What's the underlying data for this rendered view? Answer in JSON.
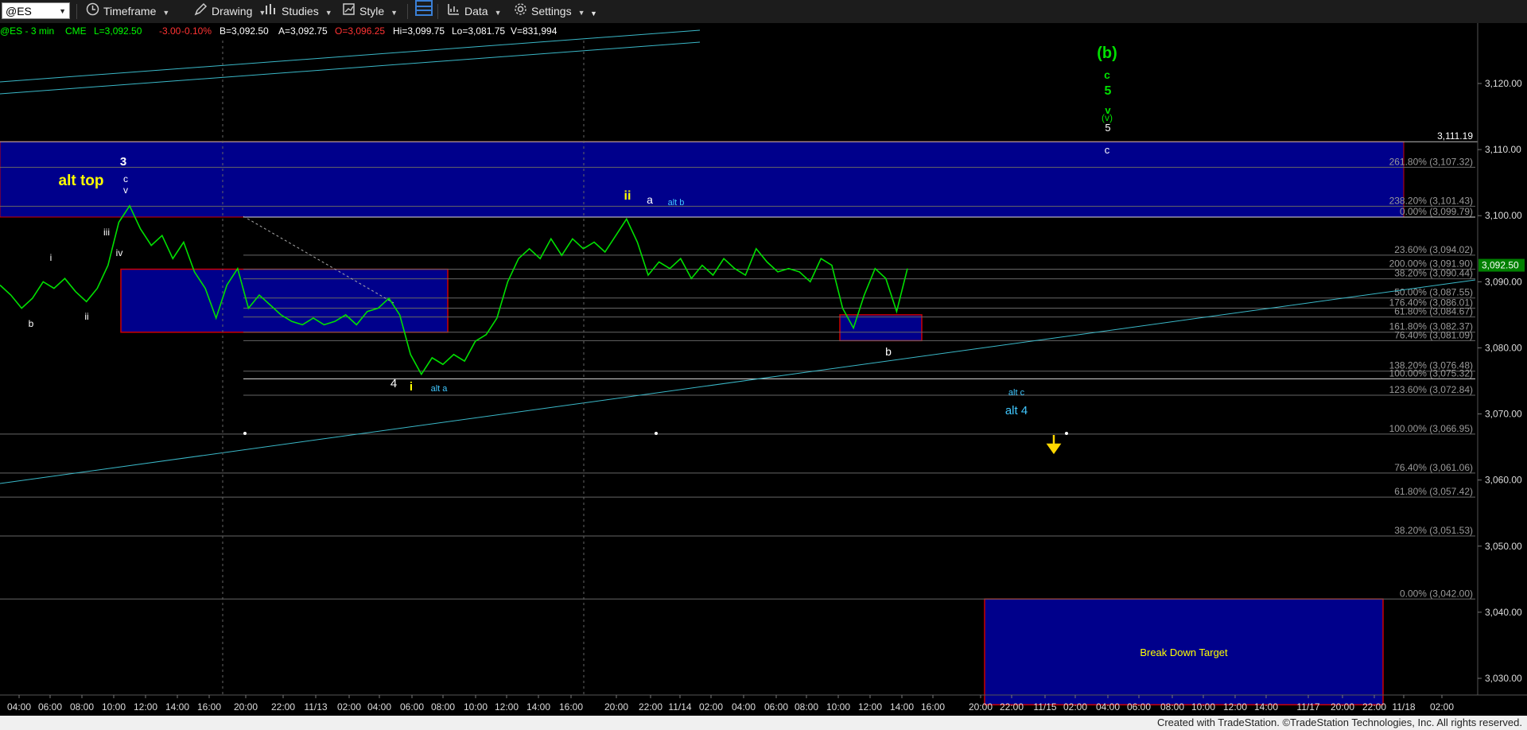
{
  "toolbar": {
    "symbol": "@ES",
    "timeframe_label": "Timeframe",
    "drawing_label": "Drawing",
    "studies_label": "Studies",
    "style_label": "Style",
    "data_label": "Data",
    "settings_label": "Settings"
  },
  "quote": {
    "instrument": "@ES - 3 min",
    "exchange": "CME",
    "last": "L=3,092.50",
    "change": "-3.00",
    "pct": "-0.10%",
    "bid": "B=3,092.50",
    "ask": "A=3,092.75",
    "open": "O=3,096.25",
    "high": "Hi=3,099.75",
    "low": "Lo=3,081.75",
    "volume": "V=831,994"
  },
  "colors": {
    "price": "#00e000",
    "box": "#00008b",
    "box_border": "#cc0000",
    "channel": "#3ab8c8",
    "fib_label": "#9a9a9a",
    "wave_white": "#ffffff",
    "wave_yellow": "#ffff00",
    "wave_cyan": "#40c8ff",
    "wave_green": "#00e000",
    "last_price_tag": "#008000"
  },
  "footer": "Created with TradeStation. ©TradeStation Technologies, Inc. All rights reserved.",
  "chart_data": {
    "type": "line",
    "title": "@ES - 3 min CME",
    "ylim": [
      3025,
      3133
    ],
    "y_ticks": [
      "3,120.00",
      "3,110.00",
      "3,100.00",
      "3,090.00",
      "3,080.00",
      "3,070.00",
      "3,060.00",
      "3,050.00",
      "3,040.00",
      "3,030.00"
    ],
    "x_ticks": [
      "04:00",
      "06:00",
      "08:00",
      "10:00",
      "12:00",
      "14:00",
      "16:00",
      "20:00",
      "22:00",
      "11/13",
      "02:00",
      "04:00",
      "06:00",
      "08:00",
      "10:00",
      "12:00",
      "14:00",
      "16:00",
      "20:00",
      "22:00",
      "11/14",
      "02:00",
      "04:00",
      "06:00",
      "08:00",
      "10:00",
      "12:00",
      "14:00",
      "16:00",
      "20:00",
      "22:00",
      "11/15",
      "02:00",
      "04:00",
      "06:00",
      "08:00",
      "10:00",
      "12:00",
      "14:00",
      "11/17",
      "20:00",
      "22:00",
      "11/18",
      "02:00"
    ],
    "last_price": "3,092.50",
    "series": [
      {
        "values": [
          3089.5,
          3088.0,
          3086.0,
          3087.5,
          3090.0,
          3089.0,
          3090.5,
          3088.5,
          3087.0,
          3089.0,
          3092.5,
          3099.0,
          3101.5,
          3098.0,
          3095.5,
          3097.0,
          3093.5,
          3096.0,
          3091.5,
          3089.0,
          3084.5,
          3089.5,
          3092.0,
          3086.0,
          3088.0,
          3086.5,
          3085.0,
          3084.0,
          3083.5,
          3084.5,
          3083.5,
          3084.0,
          3085.0,
          3083.5,
          3085.5,
          3086.0,
          3087.5,
          3085.0,
          3079.0,
          3076.0,
          3078.5,
          3077.5,
          3079.0,
          3078.0,
          3081.0,
          3082.0,
          3084.5,
          3090.0,
          3093.5,
          3095.0,
          3093.5,
          3096.5,
          3094.0,
          3096.5,
          3095.0,
          3096.0,
          3094.5,
          3097.0,
          3099.5,
          3096.0,
          3091.0,
          3093.0,
          3092.0,
          3093.5,
          3090.5,
          3092.5,
          3091.0,
          3093.5,
          3092.0,
          3091.0,
          3095.0,
          3093.0,
          3091.5,
          3092.0,
          3091.5,
          3090.0,
          3093.5,
          3092.5,
          3086.0,
          3083.0,
          3088.0,
          3092.0,
          3090.5,
          3085.5,
          3092.0
        ]
      }
    ],
    "fib_levels": [
      {
        "label": "261.80% (3,107.32)",
        "value": 3107.32
      },
      {
        "label": "238.20% (3,101.43)",
        "value": 3101.43
      },
      {
        "label": "0.00% (3,099.79)",
        "value": 3099.79
      },
      {
        "label": "23.60% (3,094.02)",
        "value": 3094.02
      },
      {
        "label": "200.00% (3,091.90)",
        "value": 3091.9
      },
      {
        "label": "38.20% (3,090.44)",
        "value": 3090.44
      },
      {
        "label": "50.00% (3,087.55)",
        "value": 3087.55
      },
      {
        "label": "176.40% (3,086.01)",
        "value": 3086.01
      },
      {
        "label": "61.80% (3,084.67)",
        "value": 3084.67
      },
      {
        "label": "161.80% (3,082.37)",
        "value": 3082.37
      },
      {
        "label": "76.40% (3,081.09)",
        "value": 3081.09
      },
      {
        "label": "138.20% (3,076.48)",
        "value": 3076.48
      },
      {
        "label": "100.00% (3,075.32)",
        "value": 3075.32
      },
      {
        "label": "123.60% (3,072.84)",
        "value": 3072.84
      },
      {
        "label": "100.00% (3,066.95)",
        "value": 3066.95
      },
      {
        "label": "76.40% (3,061.06)",
        "value": 3061.06
      },
      {
        "label": "61.80% (3,057.42)",
        "value": 3057.42
      },
      {
        "label": "38.20% (3,051.53)",
        "value": 3051.53
      },
      {
        "label": "0.00% (3,042.00)",
        "value": 3042.0
      }
    ],
    "resistance_label": "3,111.19",
    "resistance_value": 3111.19,
    "zones": [
      {
        "name": "alt-top-zone",
        "from": 3099.79,
        "to": 3111.19,
        "label": "alt top"
      },
      {
        "name": "support-zone-left",
        "from": 3082.37,
        "to": 3091.9,
        "label": ""
      },
      {
        "name": "support-zone-right",
        "from": 3081.09,
        "to": 3085.0,
        "label": ""
      },
      {
        "name": "breakdown-target-zone",
        "from": 3026.0,
        "to": 3042.0,
        "label": "Break Down Target"
      }
    ],
    "wave_labels": [
      {
        "text": "(b)",
        "color": "green"
      },
      {
        "text": "c",
        "color": "green"
      },
      {
        "text": "5",
        "color": "green"
      },
      {
        "text": "v",
        "color": "green"
      },
      {
        "text": "(v)",
        "color": "green"
      },
      {
        "text": "5",
        "color": "white"
      },
      {
        "text": "c",
        "color": "white"
      },
      {
        "text": "alt top",
        "color": "yellow"
      },
      {
        "text": "3",
        "color": "white"
      },
      {
        "text": "c",
        "color": "white"
      },
      {
        "text": "v",
        "color": "white"
      },
      {
        "text": "iii",
        "color": "white"
      },
      {
        "text": "iv",
        "color": "white"
      },
      {
        "text": "i",
        "color": "white"
      },
      {
        "text": "ii",
        "color": "white"
      },
      {
        "text": "b",
        "color": "white"
      },
      {
        "text": "ii",
        "color": "yellow"
      },
      {
        "text": "a",
        "color": "white"
      },
      {
        "text": "alt b",
        "color": "cyan"
      },
      {
        "text": "4",
        "color": "white"
      },
      {
        "text": "i",
        "color": "yellow"
      },
      {
        "text": "alt a",
        "color": "cyan"
      },
      {
        "text": "b",
        "color": "white"
      },
      {
        "text": "alt c",
        "color": "cyan"
      },
      {
        "text": "alt 4",
        "color": "cyan"
      }
    ]
  }
}
